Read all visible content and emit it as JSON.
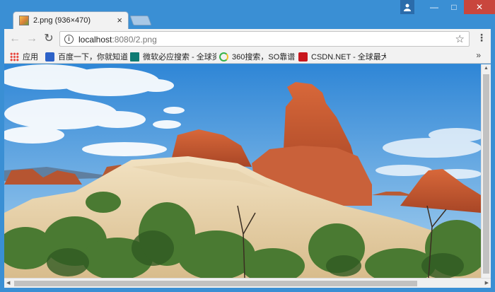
{
  "tab": {
    "title": "2.png (936×470)",
    "close": "×"
  },
  "window": {
    "minimize": "—",
    "maximize": "□",
    "close": "✕"
  },
  "nav": {
    "back": "←",
    "forward": "→",
    "reload": "↻"
  },
  "address": {
    "host": "localhost",
    "rest": ":8080/2.png"
  },
  "bookmarks": [
    {
      "label": "应用",
      "icon": "apps-grid-icon"
    },
    {
      "label": "百度一下，你就知道",
      "icon": "baidu-paw-icon"
    },
    {
      "label": "微软必应搜索 - 全球资",
      "icon": "bing-icon"
    },
    {
      "label": "360搜索，SO靠谱",
      "icon": "360-search-icon"
    },
    {
      "label": "CSDN.NET - 全球最大",
      "icon": "csdn-icon"
    }
  ],
  "bookmarks_more": "»",
  "colors": {
    "frame": "#3a8fd4",
    "tab": "#f2f2f2",
    "close_button": "#c9463d"
  }
}
